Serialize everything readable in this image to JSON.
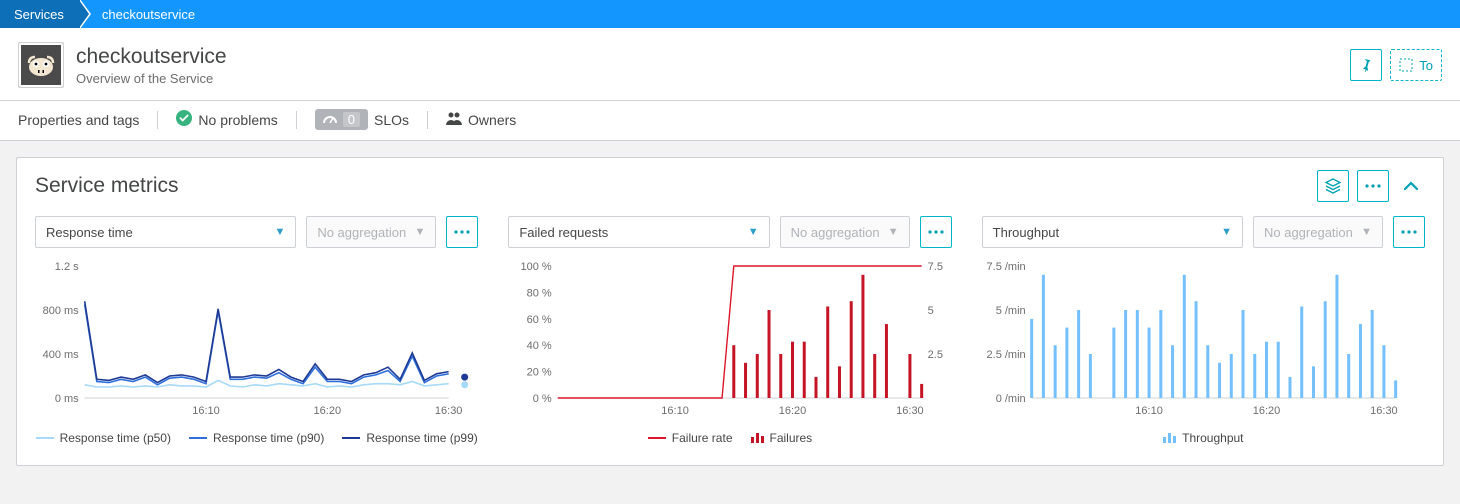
{
  "breadcrumb": {
    "root": "Services",
    "current": "checkoutservice"
  },
  "header": {
    "title": "checkoutservice",
    "subtitle": "Overview of the Service",
    "actions": {
      "toggle_label": "To"
    }
  },
  "meta": {
    "properties_label": "Properties and tags",
    "problems_label": "No problems",
    "slo_count": "0",
    "slo_label": "SLOs",
    "owners_label": "Owners"
  },
  "panel": {
    "title": "Service metrics"
  },
  "controls": {
    "no_aggregation": "No aggregation"
  },
  "chart_data": [
    {
      "type": "line",
      "title": "Response time",
      "ylabel": "",
      "y_ticks": [
        "0 ms",
        "400 ms",
        "800 ms",
        "1.2 s"
      ],
      "x_ticks": [
        "16:10",
        "16:20",
        "16:30"
      ],
      "x": [
        0,
        1,
        2,
        3,
        4,
        5,
        6,
        7,
        8,
        9,
        10,
        11,
        12,
        13,
        14,
        15,
        16,
        17,
        18,
        19,
        20,
        21,
        22,
        23,
        24,
        25,
        26,
        27,
        28,
        29,
        30
      ],
      "series": [
        {
          "name": "Response time (p50)",
          "color": "#a7d9f9",
          "values": [
            120,
            100,
            100,
            110,
            100,
            110,
            100,
            120,
            110,
            110,
            100,
            160,
            110,
            100,
            120,
            110,
            130,
            120,
            110,
            130,
            100,
            110,
            100,
            120,
            130,
            130,
            120,
            150,
            110,
            120,
            130
          ]
        },
        {
          "name": "Response time (p90)",
          "color": "#2e6fdb",
          "values": [
            850,
            150,
            140,
            170,
            150,
            190,
            120,
            180,
            190,
            170,
            130,
            790,
            170,
            170,
            190,
            180,
            230,
            170,
            130,
            280,
            150,
            150,
            130,
            190,
            210,
            250,
            150,
            380,
            140,
            200,
            220
          ]
        },
        {
          "name": "Response time (p99)",
          "color": "#1f3a93",
          "values": [
            880,
            170,
            160,
            190,
            170,
            210,
            140,
            200,
            210,
            190,
            150,
            810,
            190,
            190,
            210,
            200,
            260,
            190,
            150,
            310,
            170,
            170,
            150,
            210,
            230,
            280,
            170,
            410,
            160,
            220,
            240
          ]
        }
      ],
      "markers": [
        {
          "label": "p99",
          "color": "#1f3a93",
          "y": 190
        },
        {
          "label": "p50",
          "color": "#a7d9f9",
          "y": 120
        }
      ]
    },
    {
      "type": "mixed",
      "title": "Failed requests",
      "y_left_ticks": [
        "0 %",
        "20 %",
        "40 %",
        "60 %",
        "80 %",
        "100 %"
      ],
      "y_right_ticks": [
        "2.5",
        "5",
        "7.5"
      ],
      "x_ticks": [
        "16:10",
        "16:20",
        "16:30"
      ],
      "line_series": {
        "name": "Failure rate",
        "color": "#dc172a",
        "x": [
          0,
          1,
          2,
          3,
          4,
          5,
          6,
          7,
          8,
          9,
          10,
          11,
          12,
          13,
          14,
          15,
          16,
          17,
          18,
          19,
          20,
          21,
          22,
          23,
          24,
          25,
          26,
          27,
          28,
          29,
          30
        ],
        "values": [
          0,
          0,
          0,
          0,
          0,
          0,
          0,
          0,
          0,
          0,
          0,
          0,
          0,
          0,
          0,
          100,
          100,
          100,
          100,
          100,
          100,
          100,
          100,
          100,
          100,
          100,
          100,
          100,
          100,
          100,
          100
        ]
      },
      "bar_series": {
        "name": "Failures",
        "color": "#c41425",
        "entries": [
          {
            "x": 15,
            "v": 3
          },
          {
            "x": 16,
            "v": 2
          },
          {
            "x": 17,
            "v": 2.5
          },
          {
            "x": 18,
            "v": 5
          },
          {
            "x": 19,
            "v": 2.5
          },
          {
            "x": 20,
            "v": 3.2
          },
          {
            "x": 21,
            "v": 3.2
          },
          {
            "x": 22,
            "v": 1.2
          },
          {
            "x": 23,
            "v": 5.2
          },
          {
            "x": 24,
            "v": 1.8
          },
          {
            "x": 25,
            "v": 5.5
          },
          {
            "x": 26,
            "v": 7
          },
          {
            "x": 27,
            "v": 2.5
          },
          {
            "x": 28,
            "v": 4.2
          },
          {
            "x": 30,
            "v": 2.5
          },
          {
            "x": 31,
            "v": 0.8
          }
        ]
      }
    },
    {
      "type": "bar",
      "title": "Throughput",
      "y_ticks": [
        "0 /min",
        "2.5 /min",
        "5 /min",
        "7.5 /min"
      ],
      "x_ticks": [
        "16:10",
        "16:20",
        "16:30"
      ],
      "series_name": "Throughput",
      "color": "#74c0fc",
      "entries": [
        {
          "x": 0,
          "v": 4.5
        },
        {
          "x": 1,
          "v": 7
        },
        {
          "x": 2,
          "v": 3
        },
        {
          "x": 3,
          "v": 4
        },
        {
          "x": 4,
          "v": 5
        },
        {
          "x": 5,
          "v": 2.5
        },
        {
          "x": 7,
          "v": 4
        },
        {
          "x": 8,
          "v": 5
        },
        {
          "x": 9,
          "v": 5
        },
        {
          "x": 10,
          "v": 4
        },
        {
          "x": 11,
          "v": 5
        },
        {
          "x": 12,
          "v": 3
        },
        {
          "x": 13,
          "v": 7
        },
        {
          "x": 14,
          "v": 5.5
        },
        {
          "x": 15,
          "v": 3
        },
        {
          "x": 16,
          "v": 2
        },
        {
          "x": 17,
          "v": 2.5
        },
        {
          "x": 18,
          "v": 5
        },
        {
          "x": 19,
          "v": 2.5
        },
        {
          "x": 20,
          "v": 3.2
        },
        {
          "x": 21,
          "v": 3.2
        },
        {
          "x": 22,
          "v": 1.2
        },
        {
          "x": 23,
          "v": 5.2
        },
        {
          "x": 24,
          "v": 1.8
        },
        {
          "x": 25,
          "v": 5.5
        },
        {
          "x": 26,
          "v": 7
        },
        {
          "x": 27,
          "v": 2.5
        },
        {
          "x": 28,
          "v": 4.2
        },
        {
          "x": 29,
          "v": 5
        },
        {
          "x": 30,
          "v": 3
        },
        {
          "x": 31,
          "v": 1
        }
      ]
    }
  ]
}
